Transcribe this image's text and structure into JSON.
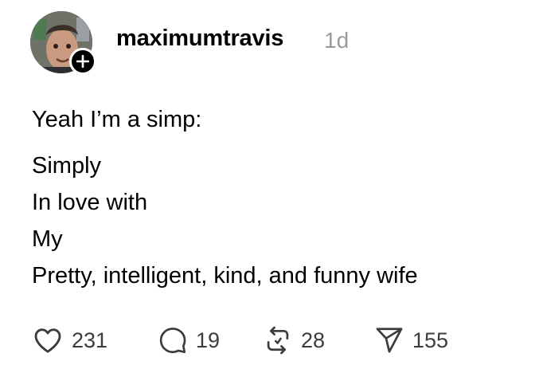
{
  "post": {
    "username": "maximumtravis",
    "timestamp": "1d",
    "lines": [
      "Yeah I’m a simp:",
      "Simply",
      "In love with",
      "My",
      "Pretty, intelligent, kind, and funny wife"
    ]
  },
  "actions": {
    "likes": "231",
    "replies": "19",
    "reposts": "28",
    "shares": "155"
  },
  "icons": {
    "like": "heart-icon",
    "reply": "comment-bubble-icon",
    "repost": "repost-arrows-icon",
    "share": "send-paper-plane-icon",
    "follow": "plus-icon"
  }
}
